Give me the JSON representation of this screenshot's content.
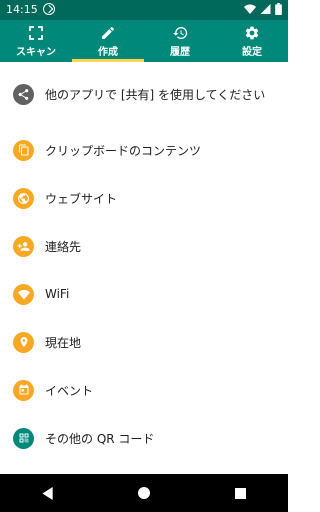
{
  "status_bar": {
    "time": "14:15"
  },
  "tabs": [
    {
      "label": "スキャン",
      "icon": "scan-icon"
    },
    {
      "label": "作成",
      "icon": "pencil-icon",
      "active": true
    },
    {
      "label": "履歴",
      "icon": "history-icon"
    },
    {
      "label": "設定",
      "icon": "gear-icon"
    }
  ],
  "list": [
    {
      "label": "他のアプリで [共有] を使用してください",
      "icon": "share-icon",
      "color": "#616161"
    },
    {
      "label": "クリップボードのコンテンツ",
      "icon": "clipboard-icon",
      "color": "#f9a825"
    },
    {
      "label": "ウェブサイト",
      "icon": "globe-icon",
      "color": "#f9a825"
    },
    {
      "label": "連絡先",
      "icon": "add-contact-icon",
      "color": "#f9a825"
    },
    {
      "label": "WiFi",
      "icon": "wifi-icon",
      "color": "#f9a825"
    },
    {
      "label": "現在地",
      "icon": "location-pin-icon",
      "color": "#f9a825"
    },
    {
      "label": "イベント",
      "icon": "calendar-icon",
      "color": "#f9a825"
    },
    {
      "label": "その他の QR コード",
      "icon": "qr-code-icon",
      "color": "#00897b"
    }
  ],
  "colors": {
    "status_bar": "#00695c",
    "app_bar": "#00897b",
    "tab_indicator": "#ffd54f",
    "accent": "#f9a825"
  }
}
